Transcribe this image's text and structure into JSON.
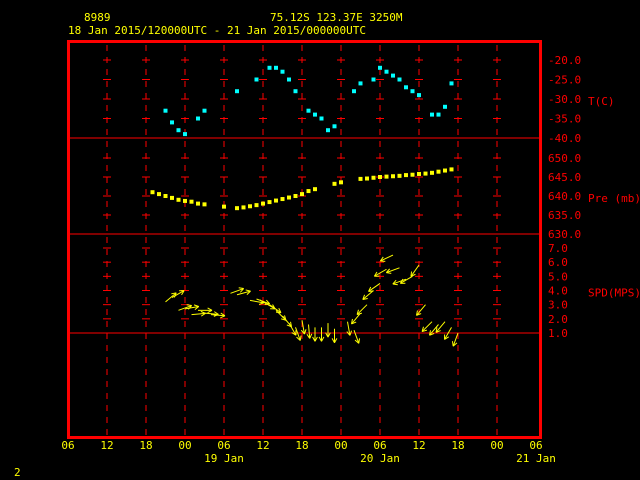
{
  "header": {
    "station": "8989",
    "location": "75.12S   123.37E   3250M",
    "period": "18 Jan 2015/120000UTC - 21 Jan 2015/000000UTC"
  },
  "footer": {
    "page": "2"
  },
  "colors": {
    "frame": "#ff0000",
    "axis_text": "#ffff00",
    "temp": "#00ffff",
    "pres": "#ffff00",
    "wind": "#ffff00",
    "right_label": "#ff0000",
    "background": "#000000"
  },
  "chart_data": [
    {
      "type": "scatter",
      "panel": "temperature",
      "ylabel": "T(C)",
      "ylim": [
        -40,
        -20
      ],
      "yticks": [
        "-20.0",
        "-25.0",
        "-30.0",
        "-35.0",
        "-40.0"
      ],
      "series": [
        {
          "points": [
            [
              15,
              -33
            ],
            [
              16,
              -36
            ],
            [
              17,
              -38
            ],
            [
              18,
              -39
            ],
            [
              20,
              -35
            ],
            [
              21,
              -33
            ],
            [
              26,
              -28
            ],
            [
              29,
              -25
            ],
            [
              31,
              -22
            ],
            [
              32,
              -22
            ],
            [
              33,
              -23
            ],
            [
              34,
              -25
            ],
            [
              35,
              -28
            ],
            [
              37,
              -33
            ],
            [
              38,
              -34
            ],
            [
              39,
              -35
            ],
            [
              40,
              -38
            ],
            [
              41,
              -37
            ],
            [
              44,
              -28
            ],
            [
              45,
              -26
            ],
            [
              47,
              -25
            ],
            [
              48,
              -22
            ],
            [
              49,
              -23
            ],
            [
              50,
              -24
            ],
            [
              51,
              -25
            ],
            [
              52,
              -27
            ],
            [
              53,
              -28
            ],
            [
              54,
              -29
            ],
            [
              56,
              -34
            ],
            [
              57,
              -34
            ],
            [
              58,
              -32
            ],
            [
              59,
              -26
            ]
          ]
        }
      ]
    },
    {
      "type": "scatter",
      "panel": "pressure",
      "ylabel": "Pre (mb)",
      "ylim": [
        630,
        650
      ],
      "yticks": [
        "650.0",
        "645.0",
        "640.0",
        "635.0",
        "630.0"
      ],
      "series": [
        {
          "points": [
            [
              13,
              641
            ],
            [
              14,
              640.5
            ],
            [
              15,
              640
            ],
            [
              16,
              639.5
            ],
            [
              17,
              639
            ],
            [
              18,
              638.7
            ],
            [
              19,
              638.5
            ],
            [
              20,
              638
            ],
            [
              21,
              637.8
            ],
            [
              24,
              637.2
            ],
            [
              26,
              636.8
            ],
            [
              27,
              637
            ],
            [
              28,
              637.3
            ],
            [
              29,
              637.6
            ],
            [
              30,
              638
            ],
            [
              31,
              638.4
            ],
            [
              32,
              638.8
            ],
            [
              33,
              639.2
            ],
            [
              34,
              639.6
            ],
            [
              35,
              640
            ],
            [
              36,
              640.5
            ],
            [
              37,
              641.3
            ],
            [
              38,
              641.8
            ],
            [
              41,
              643.2
            ],
            [
              42,
              643.6
            ],
            [
              45,
              644.5
            ],
            [
              46,
              644.6
            ],
            [
              47,
              644.8
            ],
            [
              48,
              645
            ],
            [
              49,
              645.1
            ],
            [
              50,
              645.2
            ],
            [
              51,
              645.3
            ],
            [
              52,
              645.5
            ],
            [
              53,
              645.6
            ],
            [
              54,
              645.8
            ],
            [
              55,
              645.9
            ],
            [
              56,
              646.1
            ],
            [
              57,
              646.4
            ],
            [
              58,
              646.7
            ],
            [
              59,
              647
            ]
          ]
        }
      ]
    },
    {
      "type": "scatter",
      "panel": "wind",
      "ylabel": "SPD(MPS)",
      "ylim": [
        1,
        7
      ],
      "yticks": [
        "7.0",
        "6.0",
        "5.0",
        "4.0",
        "3.0",
        "2.0",
        "1.0"
      ],
      "series": [
        {
          "points": [
            [
              15,
              3.2,
              50
            ],
            [
              16,
              3.5,
              60
            ],
            [
              17,
              2.6,
              70
            ],
            [
              18,
              2.7,
              80
            ],
            [
              19,
              2.3,
              85
            ],
            [
              20,
              2.6,
              90
            ],
            [
              21,
              2.4,
              95
            ],
            [
              22,
              2.3,
              95
            ],
            [
              25,
              3.8,
              70
            ],
            [
              26,
              3.7,
              75
            ],
            [
              28,
              3.3,
              100
            ],
            [
              29,
              3.4,
              110
            ],
            [
              30,
              3.2,
              120
            ],
            [
              31,
              3.0,
              125
            ],
            [
              32,
              2.6,
              135
            ],
            [
              33,
              2.2,
              140
            ],
            [
              34,
              1.7,
              150
            ],
            [
              35,
              1.4,
              160
            ],
            [
              36,
              1.9,
              170
            ],
            [
              37,
              1.6,
              175
            ],
            [
              38,
              1.4,
              180
            ],
            [
              39,
              1.4,
              180
            ],
            [
              40,
              1.7,
              180
            ],
            [
              41,
              1.3,
              180
            ],
            [
              43,
              1.8,
              170
            ],
            [
              44,
              1.2,
              160
            ],
            [
              45,
              2.4,
              220
            ],
            [
              46,
              3.0,
              225
            ],
            [
              47,
              4.0,
              230
            ],
            [
              48,
              4.5,
              235
            ],
            [
              49,
              5.5,
              240
            ],
            [
              50,
              6.5,
              245
            ],
            [
              51,
              5.6,
              250
            ],
            [
              52,
              4.8,
              250
            ],
            [
              53,
              5.0,
              240
            ],
            [
              54,
              5.8,
              215
            ],
            [
              55,
              3.0,
              220
            ],
            [
              56,
              1.8,
              225
            ],
            [
              57,
              1.6,
              220
            ],
            [
              58,
              1.8,
              220
            ],
            [
              59,
              1.4,
              210
            ],
            [
              60,
              1.0,
              200
            ]
          ]
        }
      ]
    }
  ],
  "x_axis": {
    "tick_labels": [
      "06",
      "12",
      "18",
      "00",
      "06",
      "12",
      "18",
      "00",
      "06",
      "12",
      "18",
      "00",
      "06"
    ],
    "date_labels": [
      {
        "hour": 24,
        "text": "19 Jan"
      },
      {
        "hour": 48,
        "text": "20 Jan"
      },
      {
        "hour": 72,
        "text": "21 Jan"
      }
    ]
  }
}
